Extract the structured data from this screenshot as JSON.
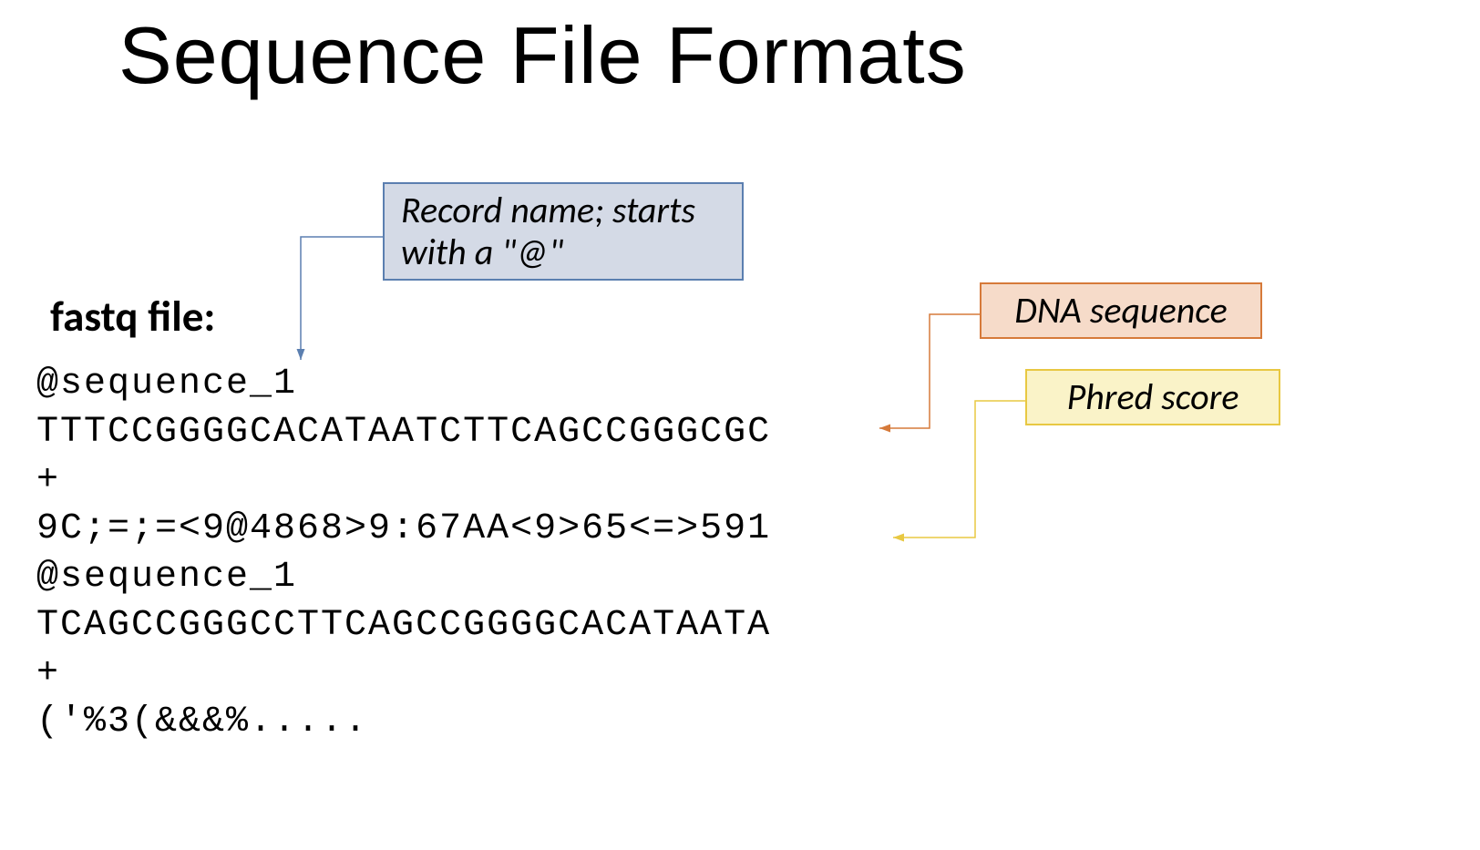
{
  "title": "Sequence File Formats",
  "subtitle": "fastq file:",
  "callouts": {
    "record": "Record name;\nstarts with a \"@\"",
    "dna": "DNA sequence",
    "phred": "Phred score"
  },
  "fastq": {
    "header1": "@sequence_1",
    "seq1": "TTTCCGGGGCACATAATCTTCAGCCGGGCGC",
    "plus1": "+",
    "qual1": "9C;=;=<9@4868>9:67AA<9>65<=>591",
    "header2": "@sequence_1",
    "seq2": "TCAGCCGGGCCTTCAGCCGGGGCACATAATA",
    "plus2": "+",
    "qual2": "('%3(&&&%....."
  }
}
